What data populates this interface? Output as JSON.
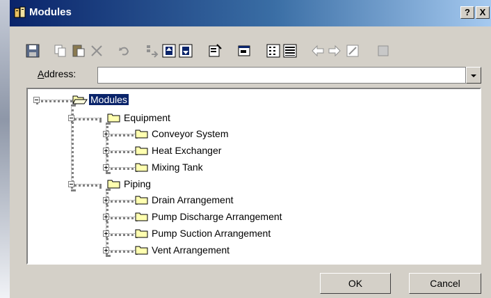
{
  "window": {
    "title": "Modules",
    "help_button": "?",
    "close_button": "X"
  },
  "address": {
    "label_mnemonic": "A",
    "label_rest": "ddress:",
    "value": ""
  },
  "tree": {
    "root": "Modules",
    "groups": [
      {
        "label": "Equipment",
        "children": [
          "Conveyor System",
          "Heat Exchanger",
          "Mixing Tank"
        ]
      },
      {
        "label": "Piping",
        "children": [
          "Drain Arrangement",
          "Pump Discharge Arrangement",
          "Pump Suction Arrangement",
          "Vent Arrangement"
        ]
      }
    ]
  },
  "buttons": {
    "ok": "OK",
    "cancel": "Cancel"
  },
  "toolbar_icons": [
    "save-icon",
    "copy-icon",
    "paste-icon",
    "delete-icon",
    "undo-icon",
    "insert-icon",
    "move-up-icon",
    "move-down-icon",
    "properties-icon",
    "window-icon",
    "list-view-icon",
    "details-view-icon",
    "back-arrow-icon",
    "forward-arrow-icon",
    "edit-icon",
    "extra-icon"
  ],
  "colors": {
    "title_start": "#0a246a",
    "title_end": "#a6caf0",
    "selection": "#0a246a",
    "folder": "#ffffb0"
  }
}
